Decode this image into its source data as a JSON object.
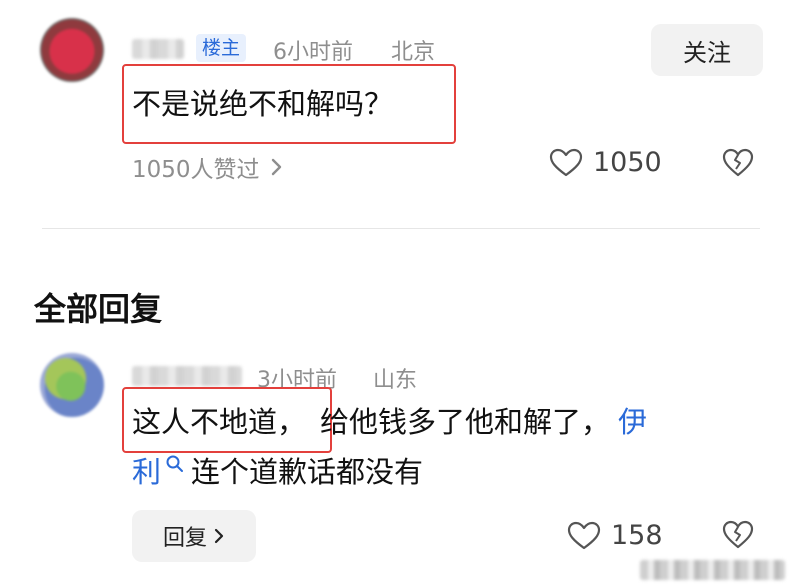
{
  "post": {
    "badge": "楼主",
    "time": "6小时前",
    "location": "北京",
    "follow_label": "关注",
    "text": "不是说绝不和解吗？",
    "likers_text": "1050人赞过",
    "like_count": "1050"
  },
  "replies_section": {
    "title": "全部回复"
  },
  "reply": {
    "time": "3小时前",
    "location": "山东",
    "text_highlighted": "这人不地道，",
    "text_rest": "给他钱多了他和解了，",
    "link_text_a": "伊",
    "link_text_b": "利",
    "text_after_link": "连个道歉话都没有",
    "reply_button": "回复",
    "like_count": "158"
  },
  "icons": {
    "chevron": "chevron-right-icon",
    "heart": "heart-outline-icon",
    "dislike": "broken-heart-icon",
    "search": "search-icon"
  },
  "colors": {
    "highlight_box": "#e3403c",
    "link": "#2a6ad8",
    "badge_bg": "#e8f0fd"
  }
}
